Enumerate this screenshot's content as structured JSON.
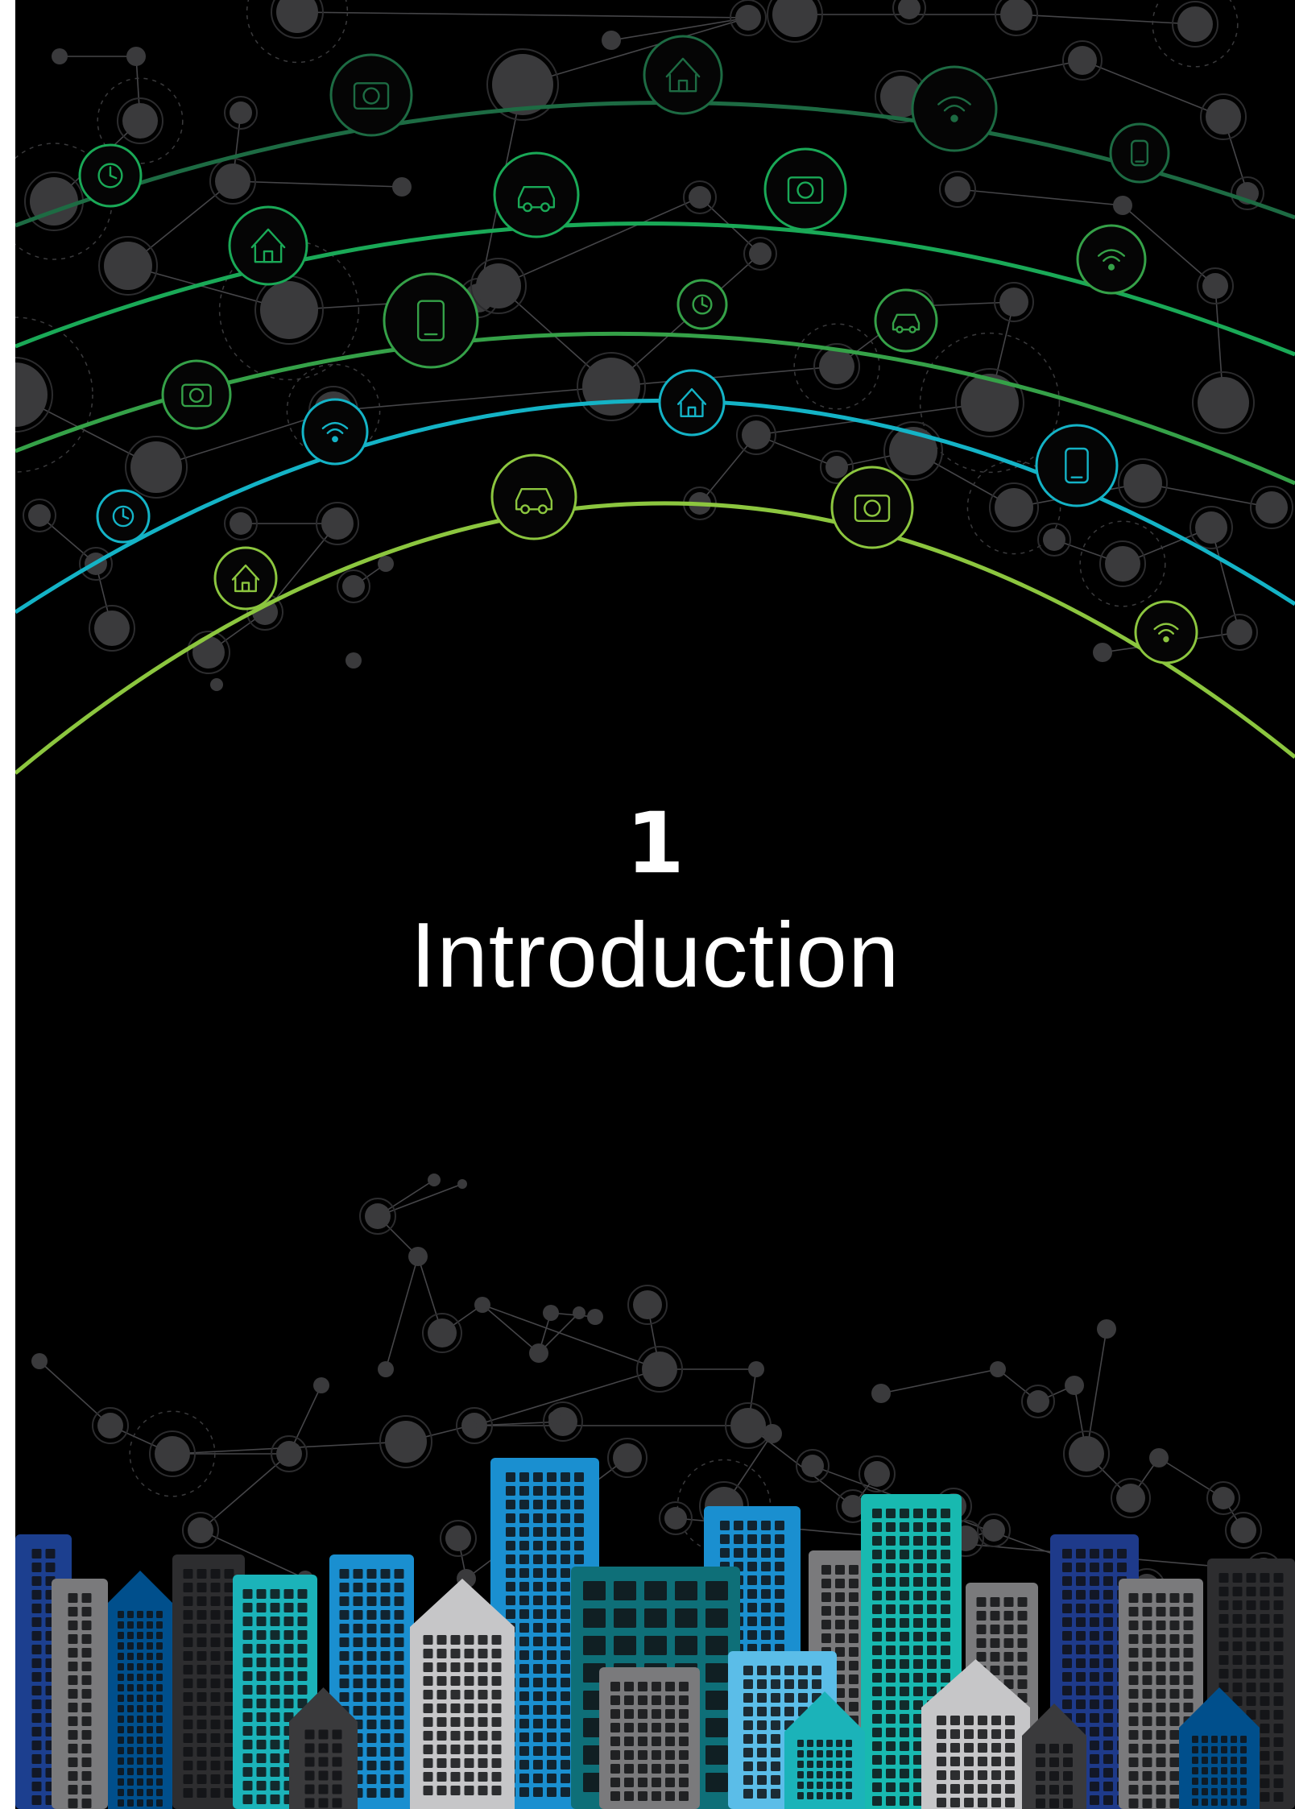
{
  "chapter": {
    "number": "1",
    "title": "Introduction"
  },
  "colors": {
    "background": "#000000",
    "node": "#3a3a3c",
    "arcs": [
      "#1d6b43",
      "#1aa957",
      "#35a148",
      "#14b3c6",
      "#8cc63f"
    ],
    "buildings": [
      "#1c3f8f",
      "#7a7a7c",
      "#004f8c",
      "#2d2d2f",
      "#1bb3b9",
      "#1a8fd0",
      "#c6c6c8",
      "#0e6f78",
      "#5bbde8",
      "#3a3a3c",
      "#18b9b0",
      "#1e3a8a"
    ]
  },
  "icons": [
    "tractor-icon",
    "smart-bin-icon",
    "smart-parking-icon",
    "smart-lighting-icon",
    "smart-bulb-icon",
    "washing-machine-icon",
    "smart-home-phone-icon",
    "cloud-wifi-icon",
    "connected-car-icon",
    "smart-house-icon",
    "smart-door-icon",
    "smart-greenhouse-icon",
    "smart-thermometer-icon",
    "smart-thermostat-icon",
    "smart-grid-icon",
    "headset-icon",
    "smart-factory-icon",
    "smartwatch-icon",
    "tablet-touch-icon",
    "wifi-icon",
    "harvester-icon"
  ]
}
